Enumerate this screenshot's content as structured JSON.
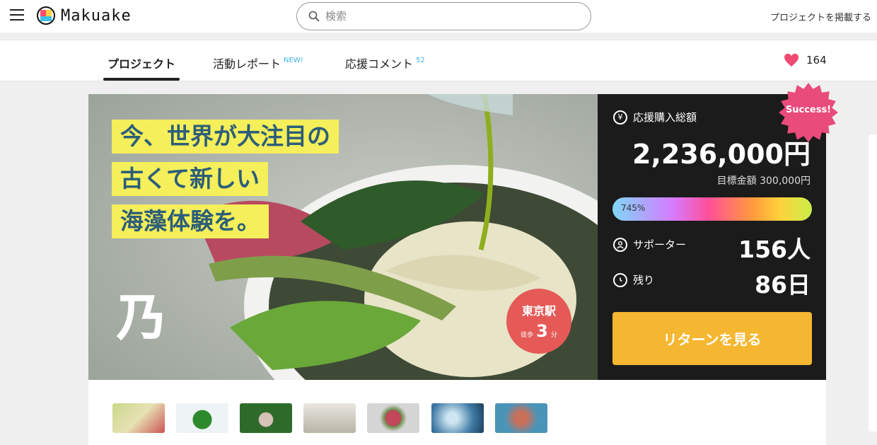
{
  "header": {
    "logo_text": "Makuake",
    "search_placeholder": "検索",
    "post_project": "プロジェクトを掲載する"
  },
  "tabs": {
    "project": "プロジェクト",
    "report": "活動レポート",
    "report_badge": "NEW!",
    "comments": "応援コメント",
    "comments_count": "52"
  },
  "favorites": {
    "count": "164"
  },
  "hero": {
    "headline_lines": [
      "今、世界が大注目の",
      "古くて新しい",
      "海藻体験を。"
    ],
    "station_name": "東京駅",
    "station_walk_prefix": "徒歩",
    "station_walk_minutes": "3",
    "station_walk_unit": "分"
  },
  "panel": {
    "total_label": "応援購入総額",
    "total_amount": "2,236,000円",
    "goal": "目標金額 300,000円",
    "progress_label": "745%",
    "progress_value": 745,
    "supporters_label": "サポーター",
    "supporters_value": "156人",
    "remaining_label": "残り",
    "remaining_value": "86日",
    "return_button": "リターンを見る",
    "success_badge": "Success!"
  },
  "thumbnails": [
    {
      "name": "thumb-1"
    },
    {
      "name": "thumb-2"
    },
    {
      "name": "thumb-3"
    },
    {
      "name": "thumb-4"
    },
    {
      "name": "thumb-5"
    },
    {
      "name": "thumb-6"
    },
    {
      "name": "thumb-7"
    }
  ],
  "colors": {
    "accent_yellow": "#f5b731",
    "success_pink": "#e94b7a",
    "heart": "#ef4a73",
    "panel_bg": "#1b1b1b"
  }
}
